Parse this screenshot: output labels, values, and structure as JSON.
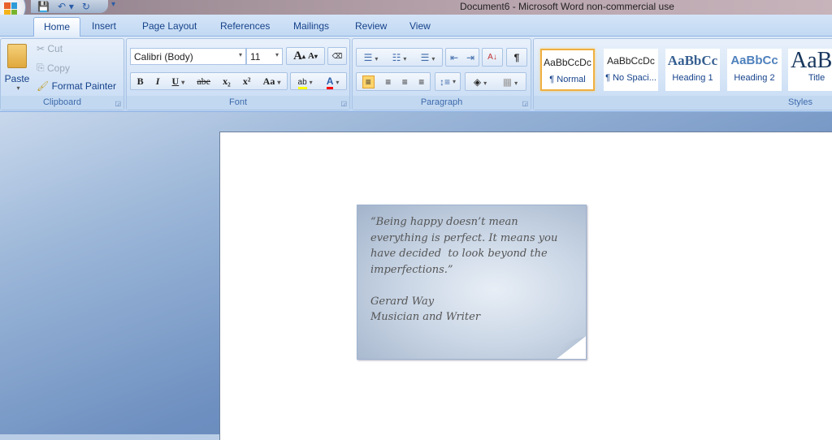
{
  "window": {
    "title": "Document6 - Microsoft Word non-commercial use"
  },
  "tabs": [
    "Home",
    "Insert",
    "Page Layout",
    "References",
    "Mailings",
    "Review",
    "View"
  ],
  "clipboard": {
    "paste": "Paste",
    "cut": "Cut",
    "copy": "Copy",
    "format_painter": "Format Painter",
    "label": "Clipboard"
  },
  "font": {
    "name": "Calibri (Body)",
    "size": "11",
    "label": "Font",
    "bold": "B",
    "italic": "I",
    "underline": "U",
    "strike": "abe",
    "subscript": "x₂",
    "superscript": "x²",
    "change_case": "Aa",
    "grow": "A",
    "shrink": "A",
    "highlight_color": "#ffff00",
    "font_color": "#ff0000"
  },
  "paragraph": {
    "label": "Paragraph",
    "pilcrow": "¶"
  },
  "styles": {
    "label": "Styles",
    "items": [
      {
        "preview": "AaBbCcDc",
        "name": "¶ Normal"
      },
      {
        "preview": "AaBbCcDc",
        "name": "¶ No Spaci..."
      },
      {
        "preview": "AaBbCc",
        "name": "Heading 1"
      },
      {
        "preview": "AaBbCc",
        "name": "Heading 2"
      },
      {
        "preview": "AaB",
        "name": "Title"
      }
    ]
  },
  "document": {
    "quote": "“Being happy doesn’t mean\neverything is perfect. It means you\nhave decided  to look beyond the\nimperfections.”",
    "author": "Gerard Way",
    "role": "Musician and Writer"
  }
}
